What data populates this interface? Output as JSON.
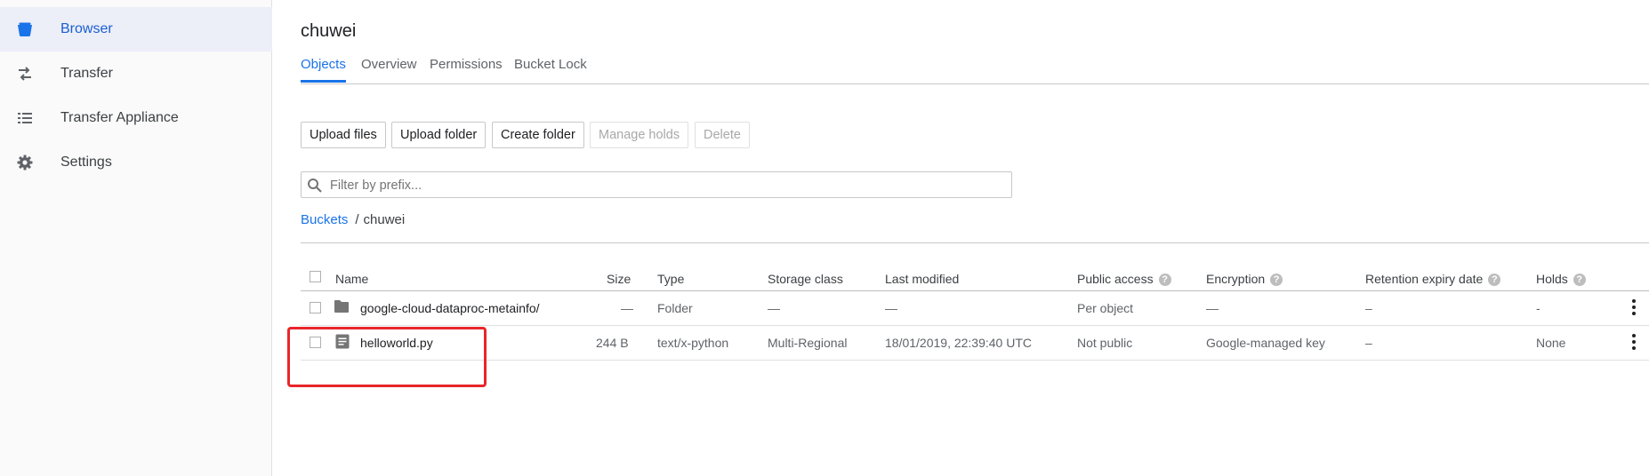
{
  "sidebar": {
    "items": [
      {
        "label": "Browser",
        "icon": "bucket-icon",
        "active": true
      },
      {
        "label": "Transfer",
        "icon": "transfer-arrows-icon"
      },
      {
        "label": "Transfer Appliance",
        "icon": "list-icon"
      },
      {
        "label": "Settings",
        "icon": "gear-icon"
      }
    ]
  },
  "page": {
    "title": "chuwei"
  },
  "tabs": [
    "Objects",
    "Overview",
    "Permissions",
    "Bucket Lock"
  ],
  "toolbar": {
    "upload_files": "Upload files",
    "upload_folder": "Upload folder",
    "create_folder": "Create folder",
    "manage_holds": "Manage holds",
    "delete": "Delete"
  },
  "filter": {
    "placeholder": "Filter by prefix..."
  },
  "breadcrumb": {
    "link": "Buckets",
    "separator": "/",
    "current": "chuwei"
  },
  "table": {
    "columns": [
      "Name",
      "Size",
      "Type",
      "Storage class",
      "Last modified",
      "Public access",
      "Encryption",
      "Retention expiry date",
      "Holds"
    ],
    "rows": [
      {
        "icon": "folder-icon",
        "name": "google-cloud-dataproc-metainfo/",
        "size": "—",
        "type": "Folder",
        "storage_class": "—",
        "last_modified": "—",
        "public_access": "Per object",
        "encryption": "—",
        "retention": "–",
        "holds": "-"
      },
      {
        "icon": "file-icon",
        "name": "helloworld.py",
        "size": "244 B",
        "type": "text/x-python",
        "storage_class": "Multi-Regional",
        "last_modified": "18/01/2019, 22:39:40 UTC",
        "public_access": "Not public",
        "encryption": "Google-managed key",
        "retention": "–",
        "holds": "None"
      }
    ]
  },
  "colors": {
    "accent": "#1a73e8",
    "highlight": "#e8262a"
  }
}
